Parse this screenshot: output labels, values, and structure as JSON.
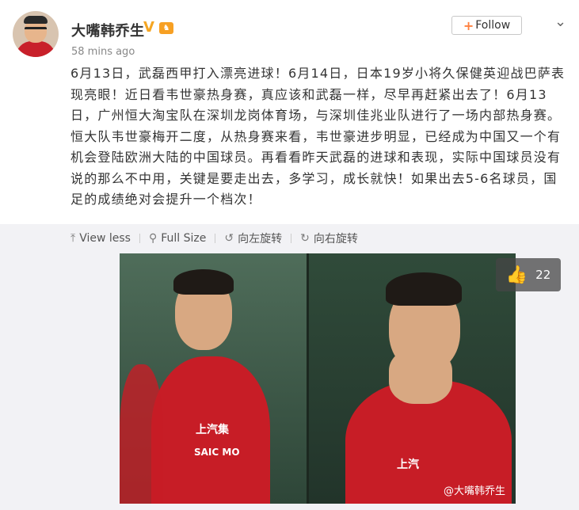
{
  "post": {
    "author": "大嘴韩乔生",
    "verified_mark": "V",
    "level_badge": "🏠",
    "timestamp": "58 mins ago",
    "follow_label": "Follow",
    "follow_plus": "+",
    "menu_icon": "chevron-down-icon",
    "text": "6月13日，武磊西甲打入漂亮进球！6月14日，日本19岁小将久保健英迎战巴萨表现亮眼！近日看韦世豪热身赛，真应该和武磊一样，尽早再赶紧出去了！6月13日，广州恒大淘宝队在深圳龙岗体育场，与深圳佳兆业队进行了一场内部热身赛。恒大队韦世豪梅开二度，从热身赛来看，韦世豪进步明显，已经成为中国又一个有机会登陆欧洲大陆的中国球员。再看看昨天武磊的进球和表现，实际中国球员没有说的那么不中用，关键是要走出去，多学习，成长就快！如果出去5-6名球员，国足的成绩绝对会提升一个档次！"
  },
  "toolbar": {
    "view_less": "View less",
    "full_size": "Full Size",
    "rotate_left": "向左旋转",
    "rotate_right": "向右旋转"
  },
  "photo": {
    "sponsor_left": "上汽集",
    "sponsor_left2": "SAIC MO",
    "sponsor_right": "上汽",
    "watermark": "@大嘴韩乔生",
    "like_count": "22"
  },
  "colors": {
    "follow_plus": "#ff8140",
    "verified": "#f5a623",
    "jersey": "#c71d26"
  }
}
